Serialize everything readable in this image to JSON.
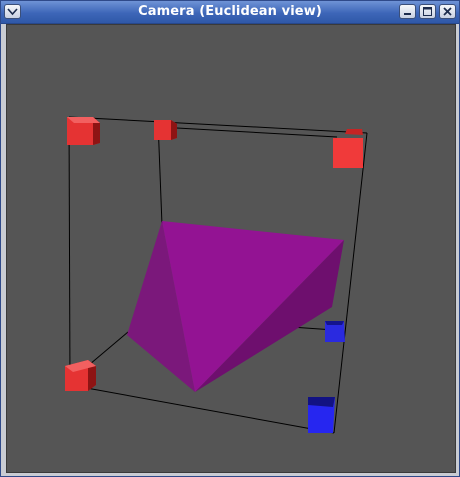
{
  "window": {
    "title": "Camera (Euclidean view)"
  },
  "titlebar_icons": [
    "chevron-down-icon",
    "minimize-icon",
    "maximize-icon",
    "close-icon"
  ],
  "colors": {
    "viewport_background": "#555555",
    "camera_marker_red": "#e53333",
    "camera_marker_blue": "#2a2ae0",
    "tetrahedron_purple": "#8f108f",
    "bounding_box_lines": "#000000"
  }
}
